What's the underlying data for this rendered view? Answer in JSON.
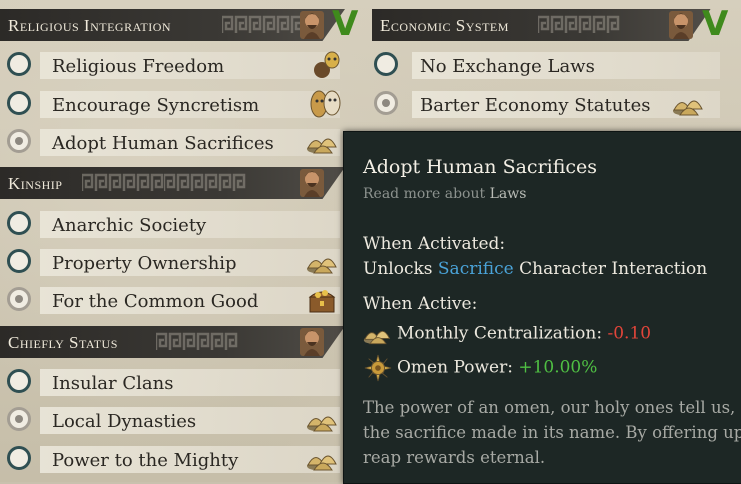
{
  "left": {
    "sections": [
      {
        "title": "Religious Integration",
        "adopted": true,
        "items": [
          {
            "label": "Religious Freedom",
            "selected": false,
            "icon": "mask-figure-icon"
          },
          {
            "label": "Encourage Syncretism",
            "selected": false,
            "icon": "masks-icon"
          },
          {
            "label": "Adopt Human Sacrifices",
            "selected": true,
            "icon": "centralization-huts-icon"
          }
        ]
      },
      {
        "title": "Kinship",
        "adopted": true,
        "items": [
          {
            "label": "Anarchic Society",
            "selected": false,
            "icon": ""
          },
          {
            "label": "Property Ownership",
            "selected": false,
            "icon": "centralization-huts-icon"
          },
          {
            "label": "For the Common Good",
            "selected": true,
            "icon": "treasure-chest-icon"
          }
        ]
      },
      {
        "title": "Chiefly Status",
        "adopted": true,
        "items": [
          {
            "label": "Insular Clans",
            "selected": false,
            "icon": ""
          },
          {
            "label": "Local Dynasties",
            "selected": true,
            "icon": "centralization-huts-icon"
          },
          {
            "label": "Power to the Mighty",
            "selected": false,
            "icon": "centralization-huts-icon"
          }
        ]
      }
    ]
  },
  "right": {
    "title": "Economic System",
    "adopted": true,
    "items": [
      {
        "label": "No Exchange Laws",
        "selected": false
      },
      {
        "label": "Barter Economy Statutes",
        "selected": true,
        "icon": "centralization-huts-icon"
      }
    ]
  },
  "tooltip": {
    "title": "Adopt Human Sacrifices",
    "read_more_prefix": "Read more about",
    "read_more_link": "Laws",
    "when_activated_heading": "When Activated:",
    "unlocks_prefix": "Unlocks",
    "unlocks_link": "Sacrifice",
    "unlocks_suffix": "Character Interaction",
    "when_active_heading": "When Active:",
    "modifiers": [
      {
        "icon": "centralization-huts-icon",
        "label": "Monthly Centralization:",
        "value": "-0.10",
        "sign": "neg"
      },
      {
        "icon": "omen-sun-icon",
        "label": "Omen Power:",
        "value": "+10.00%",
        "sign": "pos"
      }
    ],
    "flavor_lines": [
      "The power of an omen, our holy ones tell us, is",
      "the sacrifice made in its name. By offering up th",
      "reap rewards eternal."
    ]
  },
  "colors": {
    "accent_check": "#3f8a1c",
    "tooltip_bg": "#1d2725",
    "link": "#4aa3d8",
    "negative": "#e2453a",
    "positive": "#4fbf43"
  }
}
